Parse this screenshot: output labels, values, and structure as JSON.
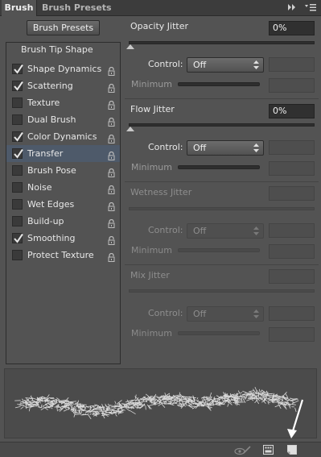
{
  "tabs": {
    "active": "Brush",
    "inactive": "Brush Presets",
    "menu_glyph": "double-arrow-menu-icon",
    "close_glyph": "close-menu-icon"
  },
  "left": {
    "presets_button": "Brush Presets",
    "tip_shape": "Brush Tip Shape",
    "items": [
      {
        "label": "Shape Dynamics",
        "checked": true,
        "selected": false
      },
      {
        "label": "Scattering",
        "checked": true,
        "selected": false
      },
      {
        "label": "Texture",
        "checked": false,
        "selected": false
      },
      {
        "label": "Dual Brush",
        "checked": false,
        "selected": false
      },
      {
        "label": "Color Dynamics",
        "checked": true,
        "selected": false
      },
      {
        "label": "Transfer",
        "checked": true,
        "selected": true
      },
      {
        "label": "Brush Pose",
        "checked": false,
        "selected": false
      },
      {
        "label": "Noise",
        "checked": false,
        "selected": false
      },
      {
        "label": "Wet Edges",
        "checked": false,
        "selected": false
      },
      {
        "label": "Build-up",
        "checked": false,
        "selected": false
      },
      {
        "label": "Smoothing",
        "checked": true,
        "selected": false
      },
      {
        "label": "Protect Texture",
        "checked": false,
        "selected": false
      }
    ]
  },
  "right": {
    "opacity_jitter": {
      "label": "Opacity Jitter",
      "value": "0%",
      "control_label": "Control:",
      "control_value": "Off",
      "minimum_label": "Minimum"
    },
    "flow_jitter": {
      "label": "Flow Jitter",
      "value": "0%",
      "control_label": "Control:",
      "control_value": "Off",
      "minimum_label": "Minimum"
    },
    "wetness_jitter": {
      "label": "Wetness Jitter",
      "control_label": "Control:",
      "control_value": "Off",
      "minimum_label": "Minimum"
    },
    "mix_jitter": {
      "label": "Mix Jitter",
      "control_label": "Control:",
      "control_value": "Off",
      "minimum_label": "Minimum"
    }
  },
  "footer": {
    "icons": [
      "eye-brush-toggle-icon",
      "grid-panel-icon",
      "create-new-preset-icon"
    ]
  },
  "colors": {
    "panel_bg": "#535353",
    "selected_row": "#4e5a6a",
    "field_dark": "#303030"
  }
}
